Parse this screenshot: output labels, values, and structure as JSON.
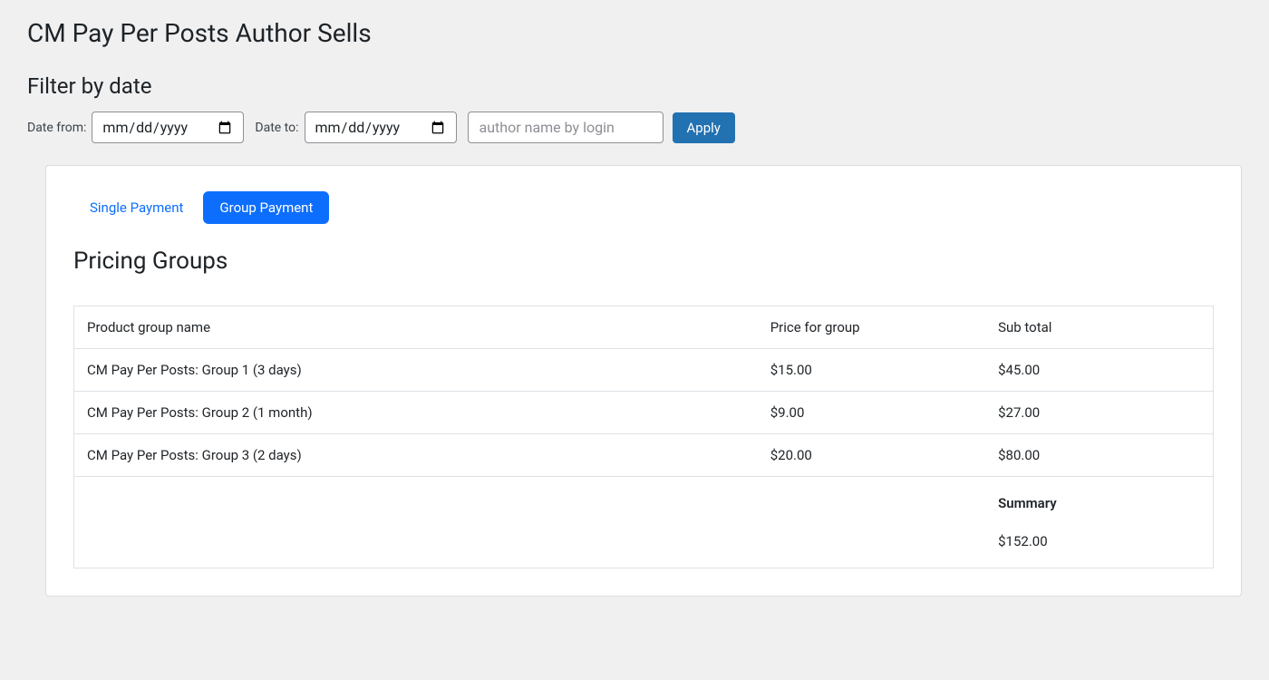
{
  "page": {
    "title": "CM Pay Per Posts Author Sells"
  },
  "filter": {
    "title": "Filter by date",
    "date_from_label": "Date from:",
    "date_to_label": "Date to:",
    "date_placeholder": "mm/dd/yyyy",
    "author_placeholder": "author name by login",
    "apply_label": "Apply"
  },
  "tabs": {
    "single": "Single Payment",
    "group": "Group Payment"
  },
  "section": {
    "title": "Pricing Groups"
  },
  "table": {
    "headers": {
      "name": "Product group name",
      "price": "Price for group",
      "sub": "Sub total"
    },
    "rows": [
      {
        "name": "CM Pay Per Posts: Group 1 (3 days)",
        "price": "$15.00",
        "sub": "$45.00"
      },
      {
        "name": "CM Pay Per Posts: Group 2 (1 month)",
        "price": "$9.00",
        "sub": "$27.00"
      },
      {
        "name": "CM Pay Per Posts: Group 3 (2 days)",
        "price": "$20.00",
        "sub": "$80.00"
      }
    ],
    "summary_label": "Summary",
    "summary_total": "$152.00"
  }
}
